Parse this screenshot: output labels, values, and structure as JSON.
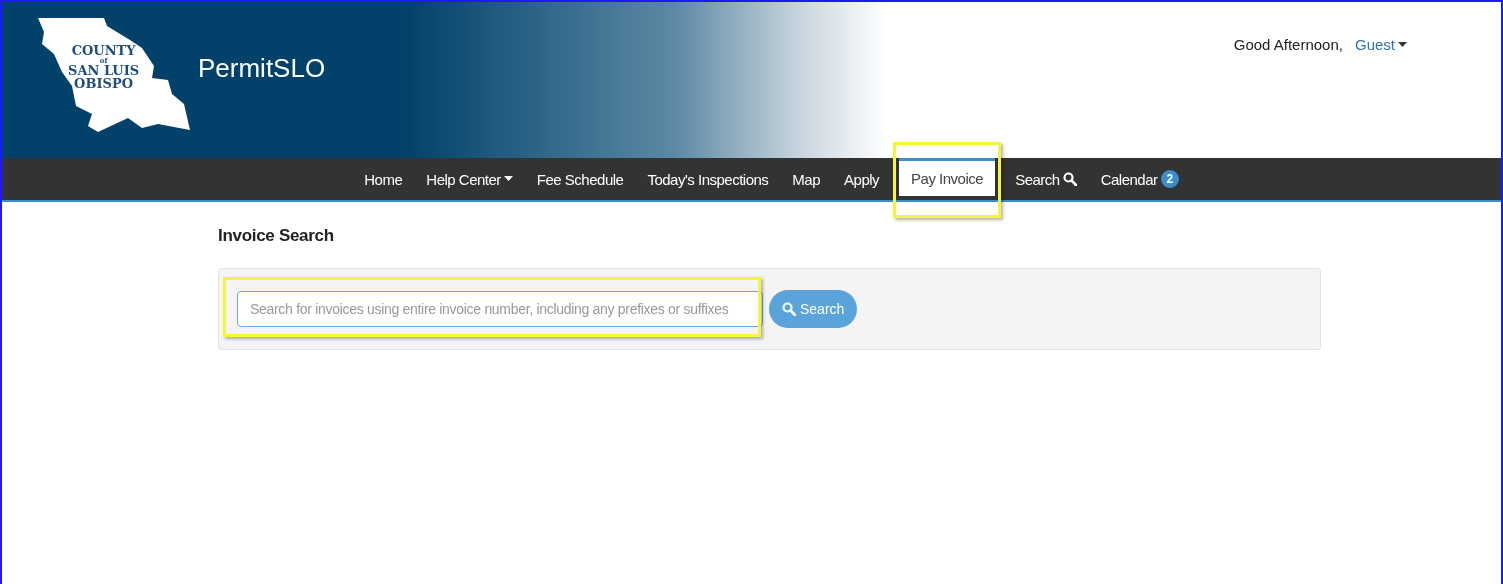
{
  "header": {
    "logo_lines": [
      "COUNTY",
      "of",
      "SAN LUIS",
      "OBISPO"
    ],
    "app_title": "PermitSLO",
    "greeting": "Good Afternoon,",
    "user": "Guest"
  },
  "nav": [
    {
      "label": "Home",
      "kind": "link",
      "selected": false,
      "highlighted": false
    },
    {
      "label": "Help Center",
      "kind": "dropdown",
      "selected": false,
      "highlighted": false
    },
    {
      "label": "Fee Schedule",
      "kind": "link",
      "selected": false,
      "highlighted": false
    },
    {
      "label": "Today's Inspections",
      "kind": "link",
      "selected": false,
      "highlighted": false
    },
    {
      "label": "Map",
      "kind": "link",
      "selected": false,
      "highlighted": false
    },
    {
      "label": "Apply",
      "kind": "link",
      "selected": false,
      "highlighted": false
    },
    {
      "label": "Pay Invoice",
      "kind": "link",
      "selected": true,
      "highlighted": true
    },
    {
      "label": "Search",
      "kind": "search",
      "selected": false,
      "highlighted": false
    },
    {
      "label": "Calendar",
      "kind": "badge",
      "badge": "2",
      "selected": false,
      "highlighted": false
    }
  ],
  "page": {
    "title": "Invoice Search",
    "search_field": {
      "placeholder": "Search for invoices using entire invoice number, including any prefixes or suffixes",
      "highlighted": true
    },
    "search_button": "Search"
  }
}
